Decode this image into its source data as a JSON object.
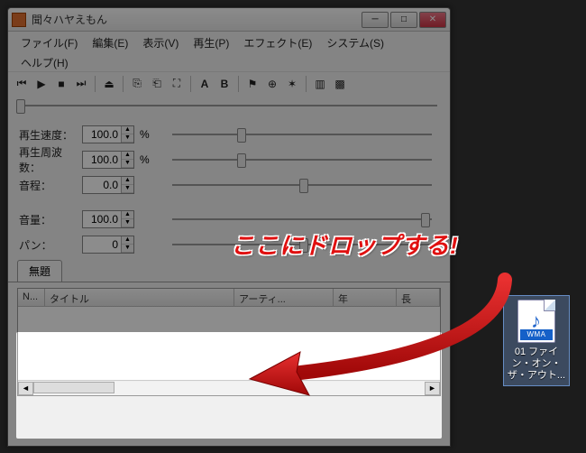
{
  "window": {
    "title": "聞々ハヤえもん",
    "buttons": {
      "min": "─",
      "max": "□",
      "close": "✕"
    }
  },
  "menu": {
    "file": "ファイル(F)",
    "edit": "編集(E)",
    "view": "表示(V)",
    "play": "再生(P)",
    "effect": "エフェクト(E)",
    "system": "システム(S)",
    "help": "ヘルプ(H)"
  },
  "controls": {
    "speed": {
      "label": "再生速度：",
      "value": "100.0",
      "unit": "%"
    },
    "freq": {
      "label": "再生周波数：",
      "value": "100.0",
      "unit": "%"
    },
    "pitch": {
      "label": "音程：",
      "value": "0.0"
    },
    "volume": {
      "label": "音量：",
      "value": "100.0"
    },
    "pan": {
      "label": "パン：",
      "value": "0"
    }
  },
  "tabs": {
    "untitled": "無題"
  },
  "table": {
    "col_no": "N...",
    "col_title": "タイトル",
    "col_artist": "アーティ...",
    "col_year": "年",
    "col_len": "長"
  },
  "desktop_file": {
    "format": "WMA",
    "name": "01 ファイン・オン・ザ・アウト..."
  },
  "callout": "ここにドロップする!"
}
